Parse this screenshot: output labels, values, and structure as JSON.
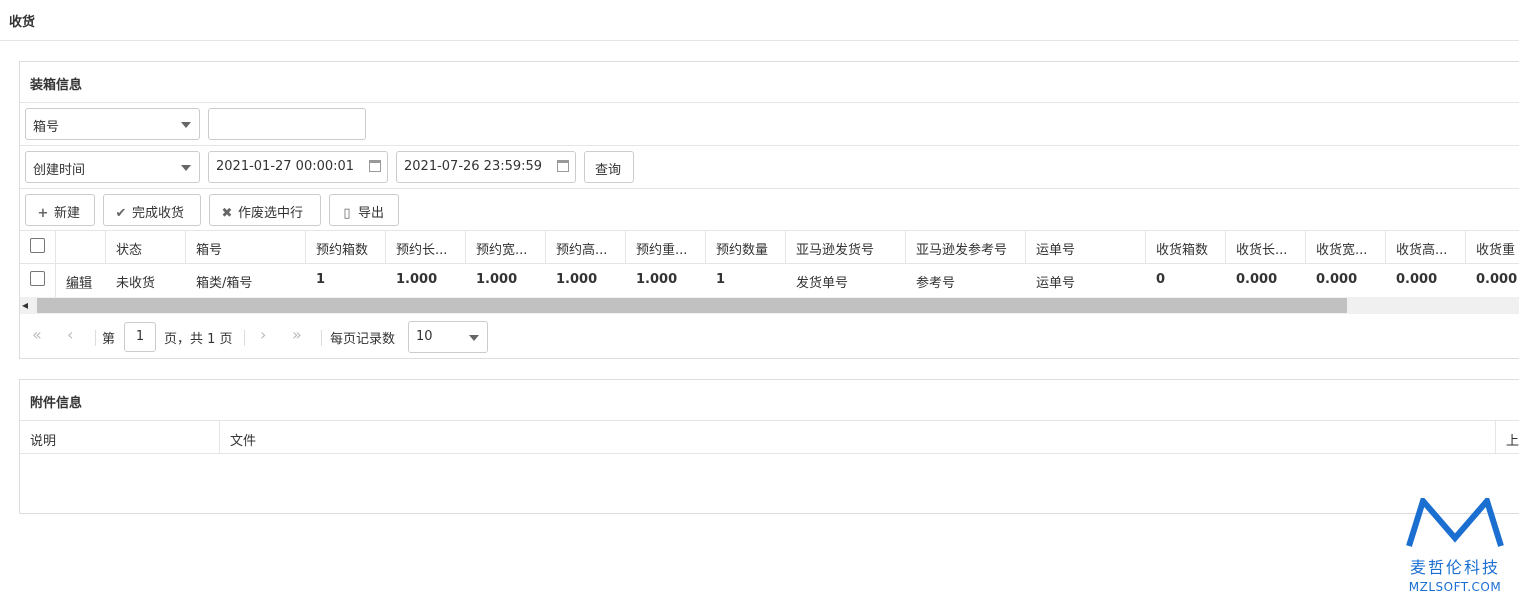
{
  "page": {
    "title": "收货"
  },
  "box_panel": {
    "title": "装箱信息",
    "filter1": {
      "field": "箱号",
      "value": ""
    },
    "filter2": {
      "field": "创建时间",
      "start": "2021-01-27 00:00:01",
      "end": "2021-07-26 23:59:59",
      "query_label": "查询"
    },
    "toolbar": {
      "new_label": "新建",
      "complete_label": "完成收货",
      "void_label": "作废选中行",
      "export_label": "导出"
    },
    "columns": [
      "状态",
      "箱号",
      "预约箱数",
      "预约长...",
      "预约宽...",
      "预约高...",
      "预约重...",
      "预约数量",
      "亚马逊发货号",
      "亚马逊发参考号",
      "运单号",
      "收货箱数",
      "收货长...",
      "收货宽...",
      "收货高...",
      "收货重"
    ],
    "rows": [
      {
        "action": "编辑",
        "cells": [
          "未收货",
          "箱类/箱号",
          "1",
          "1.000",
          "1.000",
          "1.000",
          "1.000",
          "1",
          "发货单号",
          "参考号",
          "运单号",
          "0",
          "0.000",
          "0.000",
          "0.000",
          "0.000"
        ]
      }
    ],
    "pager": {
      "page_prefix": "第",
      "page": "1",
      "page_suffix": "页，共 1 页",
      "per_page_label": "每页记录数",
      "per_page": "10"
    }
  },
  "attachment_panel": {
    "title": "附件信息",
    "columns": [
      "说明",
      "文件",
      "上"
    ]
  },
  "logo": {
    "cn": "麦哲伦科技",
    "en": "MZLSOFT.COM",
    "color": "#1a6fd0"
  }
}
